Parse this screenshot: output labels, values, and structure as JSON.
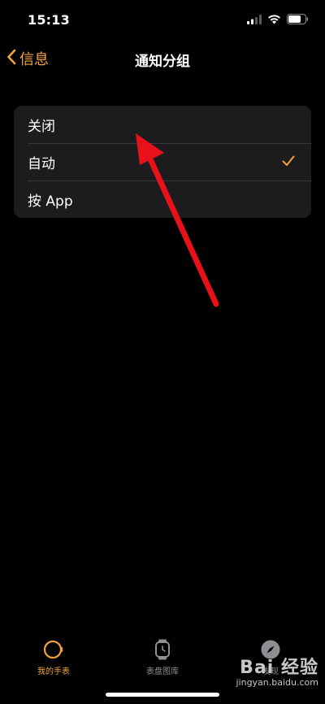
{
  "status_bar": {
    "time": "15:13"
  },
  "nav": {
    "back_label": "信息",
    "title": "通知分组"
  },
  "list": {
    "items": [
      {
        "label": "关闭",
        "selected": false
      },
      {
        "label": "自动",
        "selected": true
      },
      {
        "label": "按 App",
        "selected": false
      }
    ]
  },
  "tab_bar": {
    "items": [
      {
        "label": "我的手表",
        "icon": "watch-icon",
        "active": true
      },
      {
        "label": "表盘图库",
        "icon": "watch-face-icon",
        "active": false
      },
      {
        "label": "发现",
        "icon": "compass-icon",
        "active": false
      }
    ]
  },
  "watermark": {
    "main": "Bai 经验",
    "sub": "jingyan.baidu.com"
  },
  "colors": {
    "accent": "#f4a23b",
    "background": "#000000",
    "cell": "#1c1c1e",
    "separator": "#38383a",
    "inactive": "#8e8e93",
    "annotation_arrow": "#e8111a"
  }
}
